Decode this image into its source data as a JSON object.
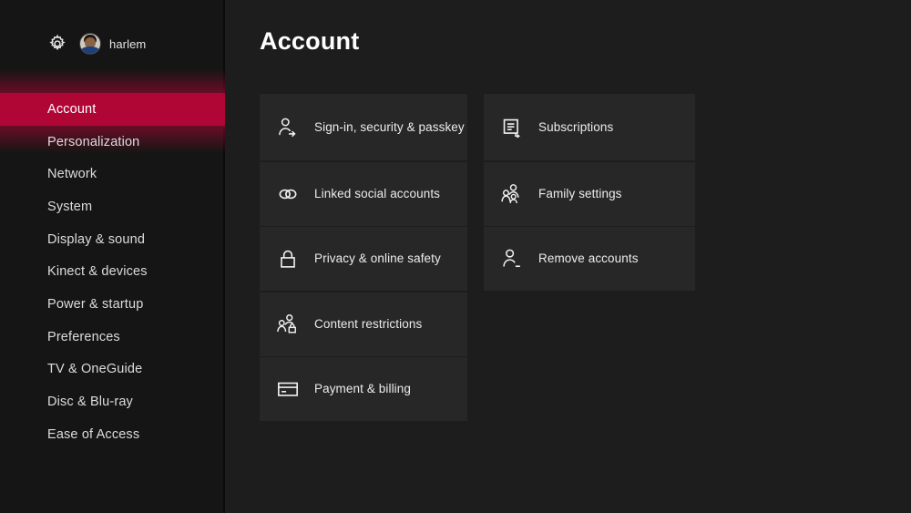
{
  "sidebar": {
    "profile": {
      "gear_icon": "gear-icon",
      "avatar_icon": "avatar",
      "name": "harlem"
    },
    "items": [
      {
        "label": "Account",
        "selected": true
      },
      {
        "label": "Personalization",
        "selected": false
      },
      {
        "label": "Network",
        "selected": false
      },
      {
        "label": "System",
        "selected": false
      },
      {
        "label": "Display & sound",
        "selected": false
      },
      {
        "label": "Kinect & devices",
        "selected": false
      },
      {
        "label": "Power & startup",
        "selected": false
      },
      {
        "label": "Preferences",
        "selected": false
      },
      {
        "label": "TV & OneGuide",
        "selected": false
      },
      {
        "label": "Disc & Blu-ray",
        "selected": false
      },
      {
        "label": "Ease of Access",
        "selected": false
      }
    ]
  },
  "main": {
    "title": "Account",
    "columns": [
      {
        "tiles": [
          {
            "label": "Sign-in, security & passkey",
            "icon": "person-arrow-icon",
            "tall": true
          },
          {
            "label": "Linked social accounts",
            "icon": "link-icon"
          },
          {
            "label": "Privacy & online safety",
            "icon": "lock-icon"
          },
          {
            "label": "Content restrictions",
            "icon": "people-lock-icon"
          },
          {
            "label": "Payment & billing",
            "icon": "credit-card-icon"
          }
        ]
      },
      {
        "tiles": [
          {
            "label": "Subscriptions",
            "icon": "document-renew-icon"
          },
          {
            "label": "Family settings",
            "icon": "people-icon"
          },
          {
            "label": "Remove accounts",
            "icon": "person-minus-icon"
          }
        ]
      }
    ]
  },
  "colors": {
    "accent": "#b00635",
    "tile_bg": "#272727",
    "content_bg": "#1d1d1d",
    "sidebar_bg": "#151515"
  }
}
